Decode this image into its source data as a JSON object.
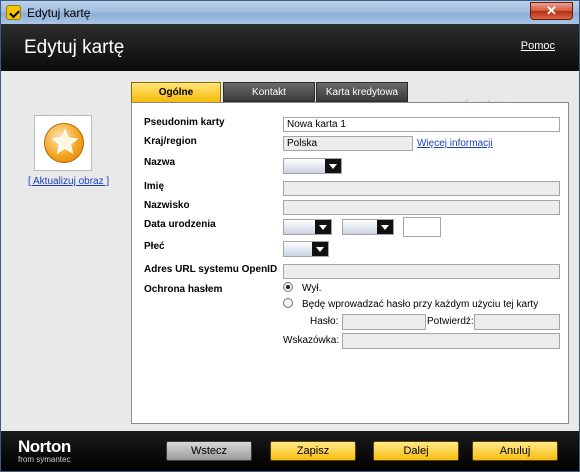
{
  "window": {
    "title": "Edytuj kartę",
    "close_glyph": "✕"
  },
  "header": {
    "title": "Edytuj kartę",
    "help": "Pomoc"
  },
  "sidebar": {
    "update_image": "[ Aktualizuj obraz ]",
    "avatar_icon": "star-icon"
  },
  "tabs": [
    {
      "label": "Ogólne",
      "active": true
    },
    {
      "label": "Kontakt",
      "active": false
    },
    {
      "label": "Karta kredytowa",
      "active": false
    }
  ],
  "watermark": "pcfoster",
  "form": {
    "nickname_label": "Pseudonim karty",
    "nickname_value": "Nowa karta 1",
    "country_label": "Kraj/region",
    "country_value": "Polska",
    "more_info": "Więcej informacji",
    "title_label": "Nazwa",
    "first_name_label": "Imię",
    "last_name_label": "Nazwisko",
    "birth_date_label": "Data urodzenia",
    "gender_label": "Płeć",
    "openid_label": "Adres URL systemu OpenID",
    "password_protect_label": "Ochrona hasłem",
    "option_off": "Wył.",
    "option_on": "Będę wprowadzać hasło przy każdym użyciu tej karty",
    "password_label": "Hasło:",
    "confirm_label": "Potwierdź:",
    "hint_label": "Wskazówka:"
  },
  "footer": {
    "brand": "Norton",
    "brand_sub": "from symantec",
    "back": "Wstecz",
    "save": "Zapisz",
    "next": "Dalej",
    "cancel": "Anuluj"
  },
  "colors": {
    "accent": "#f7bd10",
    "header_bg": "#111111",
    "link": "#1a3fbf"
  }
}
